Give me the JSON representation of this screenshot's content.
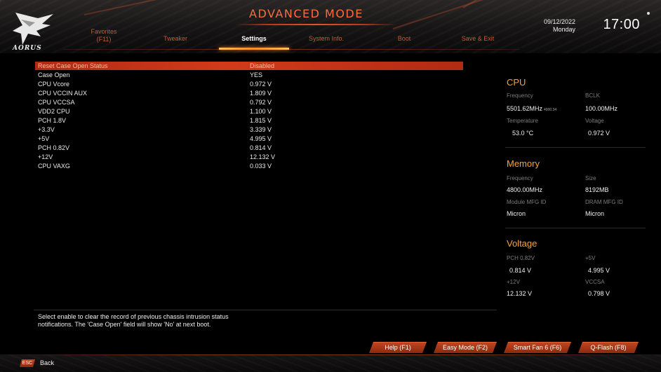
{
  "header": {
    "mode_title": "ADVANCED MODE",
    "brand_text": "AORUS",
    "date": "09/12/2022",
    "day": "Monday",
    "time": "17:00"
  },
  "tabs": [
    {
      "label_line1": "Favorites",
      "label_line2": "(F11)"
    },
    {
      "label": "Tweaker"
    },
    {
      "label": "Settings"
    },
    {
      "label": "System Info."
    },
    {
      "label": "Boot"
    },
    {
      "label": "Save & Exit"
    }
  ],
  "settings": [
    {
      "label": "Reset Case Open Status",
      "value": "Disabled"
    },
    {
      "label": "Case Open",
      "value": "YES"
    },
    {
      "label": "CPU Vcore",
      "value": "0.972 V"
    },
    {
      "label": "CPU VCCIN AUX",
      "value": "1.809 V"
    },
    {
      "label": "CPU VCCSA",
      "value": "0.792 V"
    },
    {
      "label": "VDD2 CPU",
      "value": "1.100 V"
    },
    {
      "label": "PCH 1.8V",
      "value": "1.815 V"
    },
    {
      "label": "+3.3V",
      "value": "3.339 V"
    },
    {
      "label": "+5V",
      "value": "4.995 V"
    },
    {
      "label": "PCH 0.82V",
      "value": "0.814 V"
    },
    {
      "label": "+12V",
      "value": "12.132 V"
    },
    {
      "label": "CPU VAXG",
      "value": "0.033 V"
    }
  ],
  "info": {
    "cpu": {
      "title": "CPU",
      "frequency_label": "Frequency",
      "frequency_value": "5501.62MHz",
      "frequency_sub": "4900.34",
      "bclk_label": "BCLK",
      "bclk_value": "100.00MHz",
      "temperature_label": "Temperature",
      "temperature_value": "53.0 °C",
      "voltage_label": "Voltage",
      "voltage_value": "0.972 V"
    },
    "memory": {
      "title": "Memory",
      "frequency_label": "Frequency",
      "frequency_value": "4800.00MHz",
      "size_label": "Size",
      "size_value": "8192MB",
      "module_label": "Module MFG ID",
      "module_value": "Micron",
      "dram_label": "DRAM MFG ID",
      "dram_value": "Micron"
    },
    "voltage": {
      "title": "Voltage",
      "pch_label": "PCH 0.82V",
      "pch_value": "0.814 V",
      "p5v_label": "+5V",
      "p5v_value": "4.995 V",
      "p12v_label": "+12V",
      "p12v_value": "12.132 V",
      "vccsa_label": "VCCSA",
      "vccsa_value": "0.798 V"
    }
  },
  "help": {
    "line1": "Select enable to clear the record of previous chassis intrusion status",
    "line2": "notifications. The 'Case Open' field will show 'No' at next boot."
  },
  "buttons": {
    "help": "Help (F1)",
    "easy_mode": "Easy Mode (F2)",
    "smart_fan": "Smart Fan 6 (F6)",
    "qflash": "Q-Flash (F8)"
  },
  "footer": {
    "esc": "ESC",
    "back": "Back"
  },
  "colors": {
    "accent": "#ff6a3c",
    "section_title": "#ffa22e",
    "selected_row": "#c1321a",
    "button": "#a8391a"
  }
}
